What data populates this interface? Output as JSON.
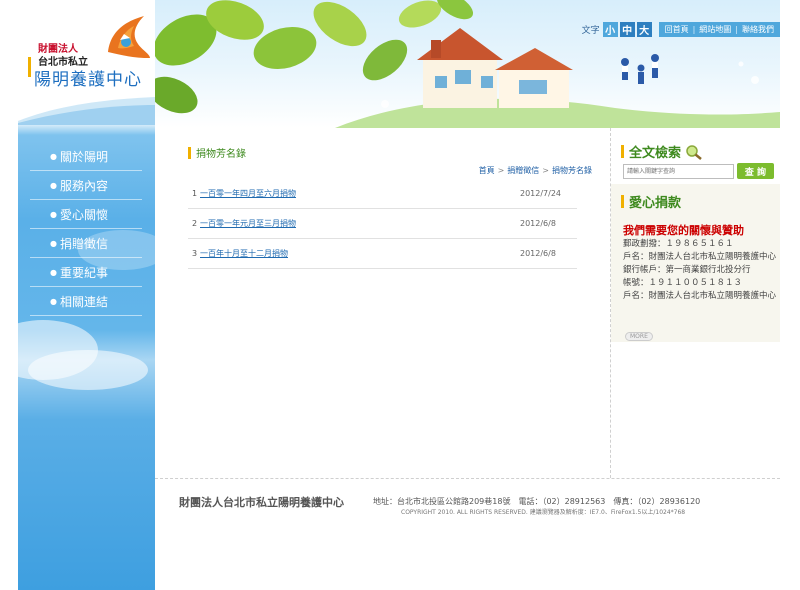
{
  "org": {
    "line1": "財團法人",
    "line2": "台北市私立",
    "line3": "陽明養護中心"
  },
  "topbar": {
    "font_label": "文字",
    "font_small": "小",
    "font_medium": "中",
    "font_large": "大",
    "links": [
      "回首頁",
      "網站地圖",
      "聯絡我們"
    ]
  },
  "nav": {
    "items": [
      "關於陽明",
      "服務內容",
      "愛心關懷",
      "捐贈徵信",
      "重要紀事",
      "相關連結"
    ]
  },
  "main": {
    "section_title": "捐物芳名錄",
    "breadcrumb": [
      "首頁",
      "捐贈徵信",
      "捐物芳名錄"
    ],
    "rows": [
      {
        "num": "1",
        "title": "一百零一年四月至六月捐物",
        "date": "2012/7/24"
      },
      {
        "num": "2",
        "title": "一百零一年元月至三月捐物",
        "date": "2012/6/8"
      },
      {
        "num": "3",
        "title": "一百年十月至十二月捐物",
        "date": "2012/6/8"
      }
    ]
  },
  "search": {
    "title": "全文檢索",
    "placeholder": "請輸入關鍵字查詢",
    "button": "查 詢"
  },
  "donate": {
    "title": "愛心捐款",
    "heading": "我們需要您的關懷與贊助",
    "lines": [
      "郵政劃撥：１９８６５１６１",
      "戶名：財團法人台北市私立陽明養護中心",
      "銀行帳戶：第一商業銀行北投分行",
      "帳號：１９１１００５１８１３",
      "戶名：財團法人台北市私立陽明養護中心"
    ],
    "more": "MORE"
  },
  "footer": {
    "org": "財團法人台北市私立陽明養護中心",
    "address": "地址：台北市北投區公館路209巷18號　電話：（02）28912563　傳真：（02）28936120",
    "copyright": "COPYRIGHT 2010. ALL RIGHTS RESERVED.  建議瀏覽器及解析度：IE7.0、FireFox1.5以上/1024*768"
  },
  "colors": {
    "accent_blue": "#4fa7dc",
    "green_title": "#3e8a1e",
    "donate_red": "#cc0000",
    "highlight_yellow": "#f0b000"
  }
}
